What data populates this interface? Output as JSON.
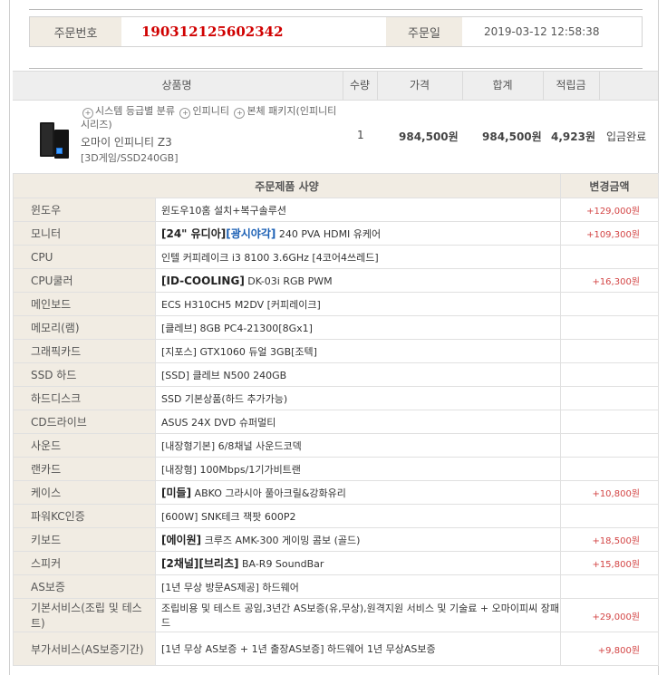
{
  "order_info": {
    "order_no_label": "주문번호",
    "order_no": "190312125602342",
    "order_date_label": "주문일",
    "order_date": "2019-03-12 12:58:38"
  },
  "product_table": {
    "headers": {
      "name": "상품명",
      "qty": "수량",
      "price": "가격",
      "total": "합계",
      "points": "적립금"
    },
    "row": {
      "cat_1": "시스템 등급별 분류",
      "cat_2": "인피니티",
      "cat_3": "본체 패키지(인피니티",
      "cat_4": "시리즈)",
      "name": "오마이 인피니티 Z3",
      "option": "[3D게임/SSD240GB]",
      "qty": "1",
      "price": "984,500원",
      "total": "984,500원",
      "points": "4,923원",
      "status": "입금완료"
    }
  },
  "spec_table": {
    "header_spec": "주문제품 사양",
    "header_amount": "변경금액",
    "rows": [
      {
        "label": "윈도우",
        "value": "윈도우10홈 설치+복구솔루션",
        "amount": "+129,000원"
      },
      {
        "label": "모니터",
        "bold": "[24\" 유디아]",
        "bold2": "[광시야각]",
        "value": " 240 PVA HDMI 유케어",
        "amount": "+109,300원"
      },
      {
        "label": "CPU",
        "value": "인텔 커피레이크 i3 8100 3.6GHz [4코어4쓰레드]",
        "amount": ""
      },
      {
        "label": "CPU쿨러",
        "bold": "[ID-COOLING]",
        "value": " DK-03i RGB PWM",
        "amount": "+16,300원"
      },
      {
        "label": "메인보드",
        "value": "ECS H310CH5 M2DV [커피레이크]",
        "amount": ""
      },
      {
        "label": "메모리(램)",
        "value": "[클레브] 8GB PC4-21300[8Gx1]",
        "amount": ""
      },
      {
        "label": "그래픽카드",
        "value": "[지포스] GTX1060 듀얼 3GB[조텍]",
        "amount": ""
      },
      {
        "label": "SSD 하드",
        "value": "[SSD] 클레브 N500 240GB",
        "amount": ""
      },
      {
        "label": "하드디스크",
        "value": "SSD 기본상품(하드 추가가능)",
        "amount": ""
      },
      {
        "label": "CD드라이브",
        "value": "ASUS 24X DVD 슈퍼멀티",
        "amount": ""
      },
      {
        "label": "사운드",
        "value": "[내장형기본] 6/8채널 사운드코덱",
        "amount": ""
      },
      {
        "label": "랜카드",
        "value": "[내장형] 100Mbps/1기가비트랜",
        "amount": ""
      },
      {
        "label": "케이스",
        "bold": "[미들]",
        "value": " ABKO 그라시아 풀아크릴&강화유리",
        "amount": "+10,800원"
      },
      {
        "label": "파워KC인증",
        "value": "[600W] SNK테크 잭팟 600P2",
        "amount": ""
      },
      {
        "label": "키보드",
        "bold": "[에이원]",
        "value": " 크루즈 AMK-300 게이밍 콤보 (골드)",
        "amount": "+18,500원"
      },
      {
        "label": "스피커",
        "bold": "[2채널][브리츠]",
        "value": " BA-R9 SoundBar",
        "amount": "+15,800원"
      },
      {
        "label": "AS보증",
        "value": "[1년 무상 방문AS제공] 하드웨어",
        "amount": ""
      },
      {
        "label": "기본서비스(조립 및 테스트)",
        "value": "조립비용 및 테스트 공임,3년간 AS보증(유,무상),원격지원 서비스 및 기술료 + 오마이피씨 장패드",
        "amount": "+29,000원",
        "tall": true
      },
      {
        "label": "부가서비스(AS보증기간)",
        "value": "[1년 무상 AS보증 + 1년 출장AS보증] 하드웨어 1년 무상AS보증",
        "amount": "+9,800원",
        "tall": true
      }
    ]
  }
}
